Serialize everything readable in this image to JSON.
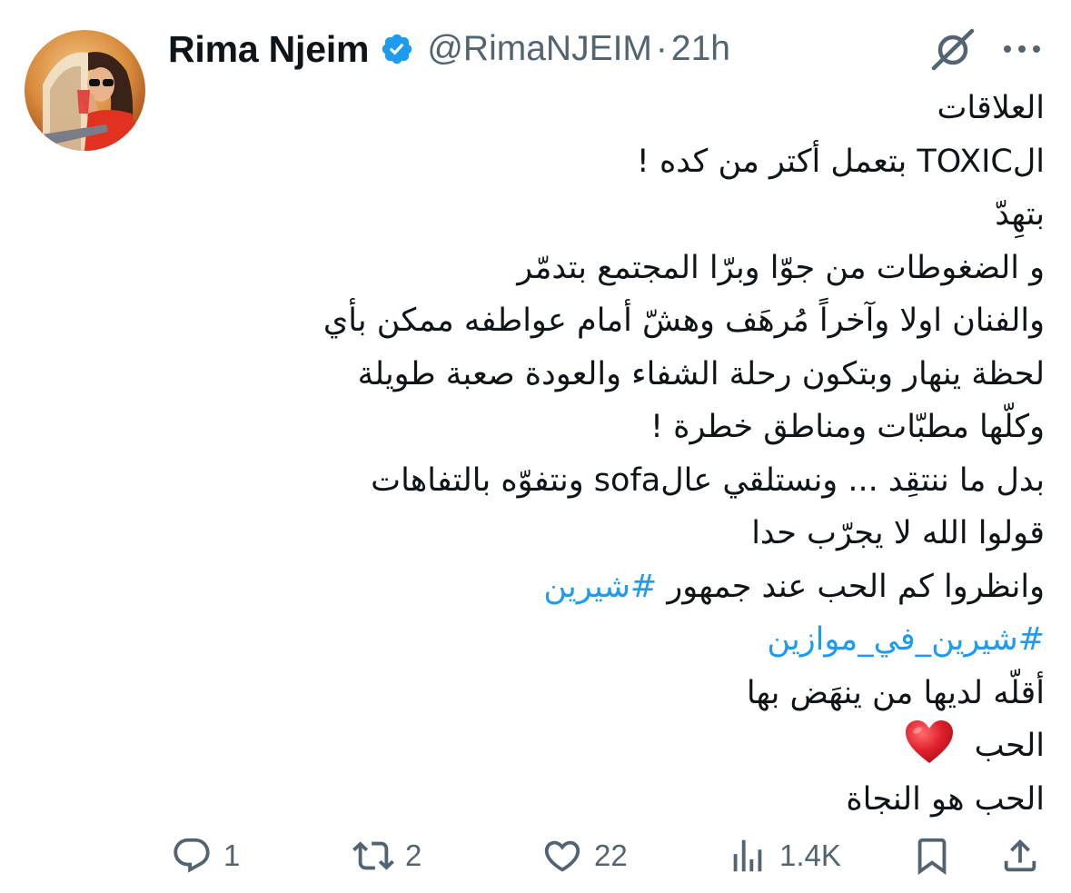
{
  "author": {
    "display_name": "Rima Njeim",
    "verified_icon": "verified-badge-icon",
    "handle": "@RimaNJEIM",
    "separator": "·",
    "time": "21h"
  },
  "header_icons": {
    "grok": "grok-icon",
    "more": "more-icon"
  },
  "tweet": {
    "lines": [
      "العلاقات",
      "الTOXIC بتعمل أكتر من كده !",
      "بتهِدّ",
      "و الضغوطات من جوّا وبرّا  المجتمع بتدمّر",
      "والفنان اولا وآخراً  مُرهَف وهشّ أمام عواطفه ممكن بأي",
      "لحظة ينهار وبتكون رحلة الشفاء والعودة  صعبة طويلة",
      "وكلّها مطبّات ومناطق خطرة !",
      "بدل ما ننتقِد ... ونستلقي عالsofa ونتفوّه بالتفاهات",
      "قولوا الله لا يجرّب حدا"
    ],
    "line10_text": "وانظروا كم الحب عند جمهور ",
    "line10_hashtag": "#شيرين",
    "line11_hashtag": "#شيرين_في_موازين",
    "line12": "أقلّه لديها من ينهَض بها",
    "line13": "الحب",
    "line13_emoji": "heart-emoji-icon",
    "line14": "الحب هو النجاة"
  },
  "colors": {
    "text": "#0f1419",
    "secondary": "#536471",
    "link": "#1d9bf0",
    "verified": "#1d9bf0",
    "heart": "#e0212c"
  },
  "actions": {
    "reply_count": "1",
    "retweet_count": "2",
    "like_count": "22",
    "views_count": "1.4K"
  }
}
